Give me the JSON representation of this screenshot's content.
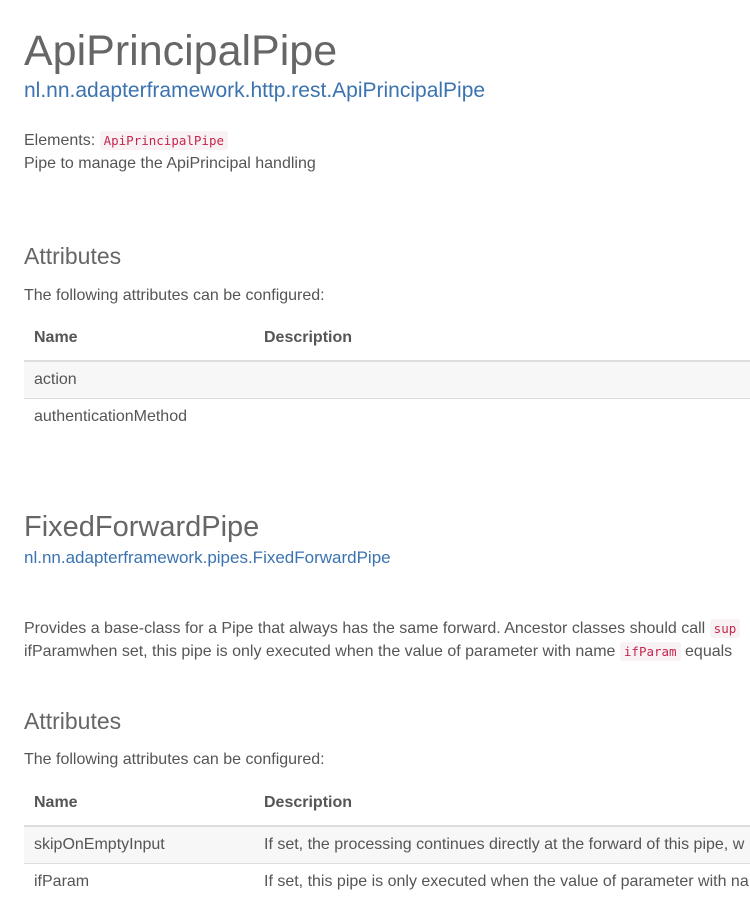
{
  "api": {
    "title": "ApiPrincipalPipe",
    "package": "nl.nn.adapterframework.http.rest.ApiPrincipalPipe",
    "elements_label": "Elements:",
    "elements_code": "ApiPrincipalPipe",
    "description": "Pipe to manage the ApiPrincipal handling",
    "attributes_heading": "Attributes",
    "attributes_intro": "The following attributes can be configured:",
    "col_name": "Name",
    "col_description": "Description",
    "rows": [
      {
        "name": "action",
        "description": ""
      },
      {
        "name": "authenticationMethod",
        "description": ""
      }
    ]
  },
  "fixed": {
    "title": "FixedForwardPipe",
    "package": "nl.nn.adapterframework.pipes.FixedForwardPipe",
    "desc_line1": "Provides a base-class for a Pipe that always has the same forward. Ancestor classes should call",
    "desc_code1": "sup",
    "desc_line2": "ifParamwhen set, this pipe is only executed when the value of parameter with name",
    "desc_code2": "ifParam",
    "desc_line2_end": "equals",
    "attributes_heading": "Attributes",
    "attributes_intro": "The following attributes can be configured:",
    "col_name": "Name",
    "col_description": "Description",
    "rows": [
      {
        "name": "skipOnEmptyInput",
        "description": "If set, the processing continues directly at the forward of this pipe, w"
      },
      {
        "name": "ifParam",
        "description": "If set, this pipe is only executed when the value of parameter with na"
      }
    ]
  }
}
